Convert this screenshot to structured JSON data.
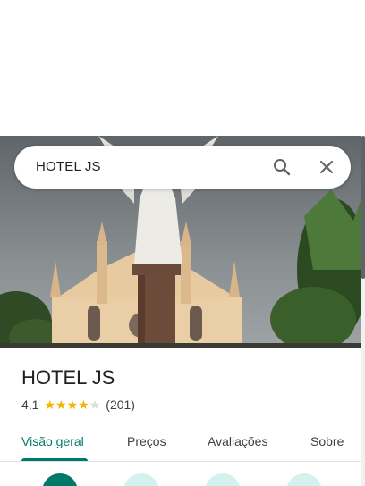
{
  "search": {
    "value": "HOTEL JS"
  },
  "place": {
    "title": "HOTEL JS",
    "rating": "4,1",
    "stars_filled": 4,
    "stars_total": 5,
    "review_count": "(201)"
  },
  "tabs": [
    {
      "label": "Visão geral",
      "active": true
    },
    {
      "label": "Preços",
      "active": false
    },
    {
      "label": "Avaliações",
      "active": false
    },
    {
      "label": "Sobre",
      "active": false
    }
  ],
  "colors": {
    "accent": "#00796b",
    "star": "#f4b400",
    "action_bg": "#d3f2ee"
  },
  "icons": {
    "search": "search-icon",
    "close": "close-icon"
  },
  "actions": [
    {
      "icon": "directions-icon"
    },
    {
      "icon": "save-icon"
    },
    {
      "icon": "nearby-icon"
    },
    {
      "icon": "share-icon"
    }
  ]
}
